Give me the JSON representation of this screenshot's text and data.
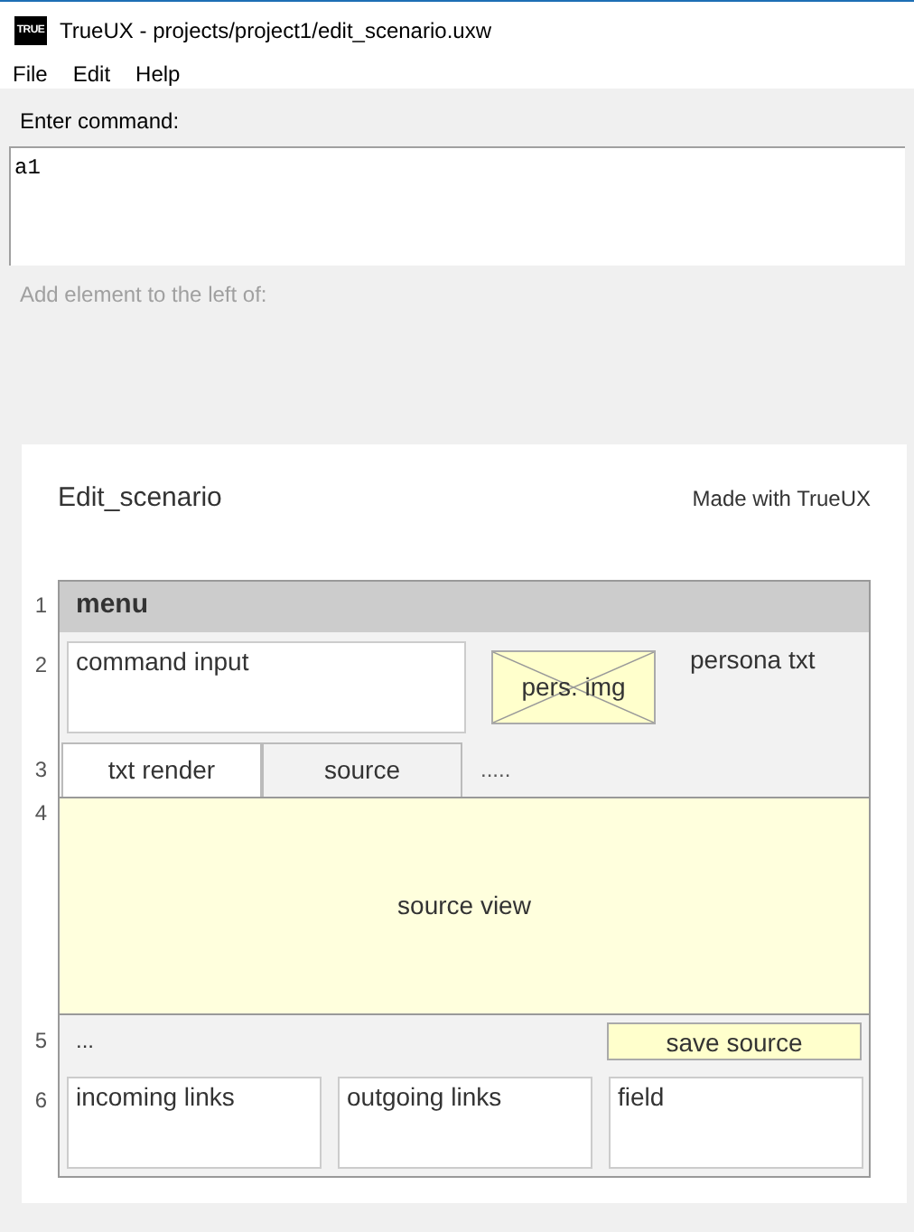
{
  "window": {
    "icon_text": "TRUE",
    "title": "TrueUX - projects/project1/edit_scenario.uxw"
  },
  "menu": [
    "File",
    "Edit",
    "Help"
  ],
  "command": {
    "label": "Enter command:",
    "value": "a1"
  },
  "hint": "Add element to the left of:",
  "preview": {
    "title": "Edit_scenario",
    "credit": "Made with TrueUX",
    "row_numbers": [
      "1",
      "2",
      "3",
      "4",
      "5",
      "6"
    ],
    "menu_bar": "menu",
    "command_input": "command input",
    "persona_image": "pers. img",
    "persona_text": "persona txt",
    "tabs": [
      {
        "label": "txt render",
        "selected": true
      },
      {
        "label": "source",
        "selected": false
      }
    ],
    "tabs_more": ".....",
    "source_view": "source view",
    "ellipsis": "...",
    "save_button": "save source",
    "panels": [
      "incoming links",
      "outgoing links",
      "field"
    ]
  }
}
